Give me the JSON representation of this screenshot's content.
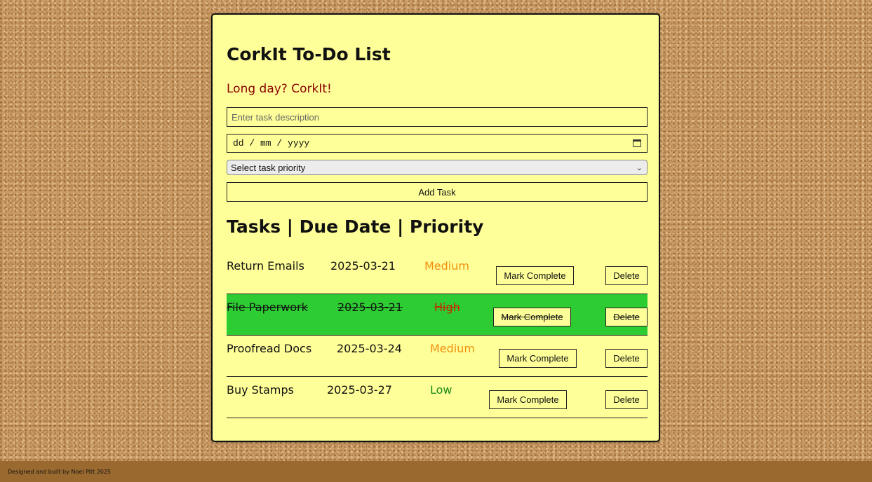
{
  "app": {
    "title": "CorkIt To-Do List",
    "tagline": "Long day? CorkIt!"
  },
  "form": {
    "description_placeholder": "Enter task description",
    "date_placeholder": "dd / mm / yyyy",
    "priority_selected": "Select task priority",
    "add_label": "Add Task"
  },
  "list": {
    "heading": "Tasks | Due Date | Priority",
    "tasks": [
      {
        "task": "Return Emails",
        "due": "2025-03-21",
        "priority": "Medium",
        "priority_color": "#f0900f",
        "completed": false,
        "mark_label": "Mark Complete",
        "delete_label": "Delete"
      },
      {
        "task": "File Paperwork",
        "due": "2025-03-21",
        "priority": "High",
        "priority_color": "#cc2200",
        "completed": true,
        "mark_label": "Mark Complete",
        "delete_label": "Delete"
      },
      {
        "task": "Proofread Docs",
        "due": "2025-03-24",
        "priority": "Medium",
        "priority_color": "#f0900f",
        "completed": false,
        "mark_label": "Mark Complete",
        "delete_label": "Delete"
      },
      {
        "task": "Buy Stamps",
        "due": "2025-03-27",
        "priority": "Low",
        "priority_color": "#1a8a1a",
        "completed": false,
        "mark_label": "Mark Complete",
        "delete_label": "Delete"
      }
    ]
  },
  "footer": {
    "credit": "Designed and built by Noel Pitt 2025"
  },
  "colors": {
    "card_background": "#ffff99",
    "completed_row": "#2ecc33",
    "footer_background": "#9a6930",
    "tagline": "#8b0000"
  }
}
